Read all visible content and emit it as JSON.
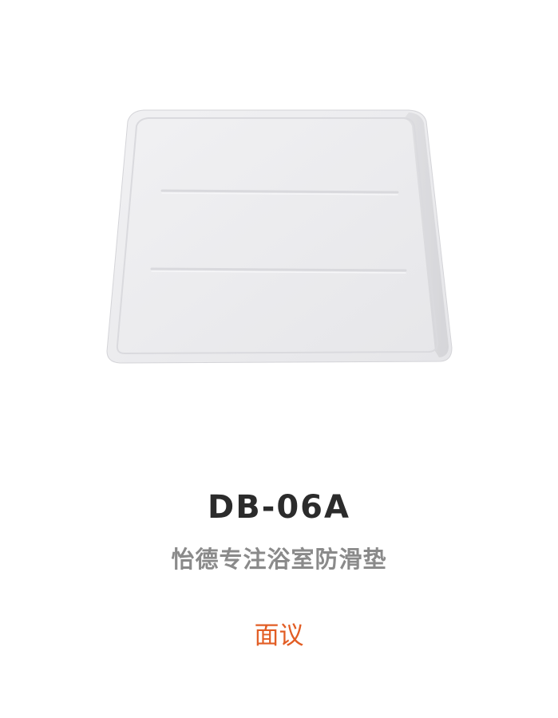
{
  "product": {
    "code": "DB-06A",
    "description": "怡德专注浴室防滑垫",
    "price_label": "面议"
  },
  "colors": {
    "code_text": "#2b2b2b",
    "description_text": "#8a8a8a",
    "price_text": "#e25d24",
    "tray": "#ebebed"
  }
}
